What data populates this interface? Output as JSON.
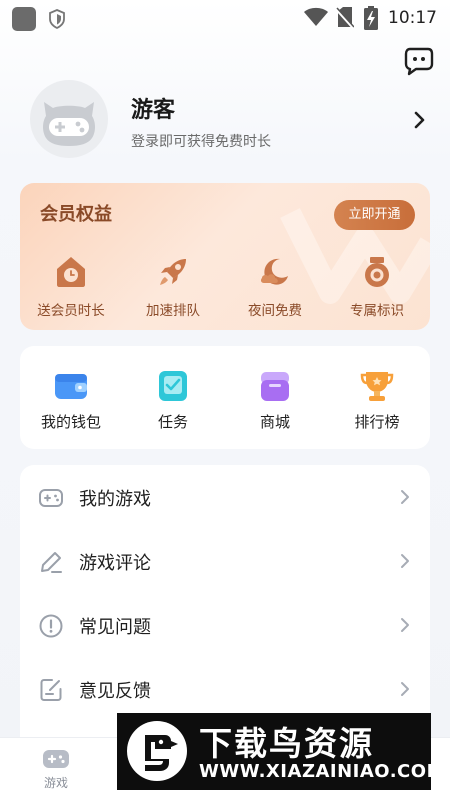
{
  "status_bar": {
    "time": "10:17",
    "icons": [
      "app-square-icon",
      "shield-icon",
      "wifi-icon",
      "no-sim-icon",
      "battery-charging-icon"
    ]
  },
  "header": {
    "message_icon": "chat-bubble-icon"
  },
  "profile": {
    "name": "游客",
    "hint": "登录即可获得免费时长",
    "avatar_icon": "gamepad-avatar-icon"
  },
  "member": {
    "title": "会员权益",
    "button": "立即开通",
    "benefits": [
      {
        "label": "送会员时长",
        "icon": "clock-tag-icon"
      },
      {
        "label": "加速排队",
        "icon": "rocket-icon"
      },
      {
        "label": "夜间免费",
        "icon": "moon-cloud-icon"
      },
      {
        "label": "专属标识",
        "icon": "medal-icon"
      }
    ],
    "colors": {
      "text": "#8a4a28",
      "button": "#c86e3a",
      "bg_start": "#fbd4bb",
      "bg_end": "#fce3d2"
    }
  },
  "tools": [
    {
      "label": "我的钱包",
      "icon": "wallet-icon",
      "color": "#3f8ff6"
    },
    {
      "label": "任务",
      "icon": "task-icon",
      "color": "#2fc6d6"
    },
    {
      "label": "商城",
      "icon": "shop-icon",
      "color": "#a46ef0"
    },
    {
      "label": "排行榜",
      "icon": "trophy-icon",
      "color": "#f59a2c"
    }
  ],
  "menu": [
    {
      "label": "我的游戏",
      "icon": "gamepad-icon"
    },
    {
      "label": "游戏评论",
      "icon": "pencil-icon"
    },
    {
      "label": "常见问题",
      "icon": "alert-circle-icon"
    },
    {
      "label": "意见反馈",
      "icon": "feedback-icon"
    }
  ],
  "tabbar": {
    "tabs": [
      {
        "label": "游戏",
        "icon": "game-tab-icon"
      }
    ]
  },
  "watermark": {
    "title": "下载鸟资源",
    "url": "WWW.XIAZAINIAO.COM"
  }
}
